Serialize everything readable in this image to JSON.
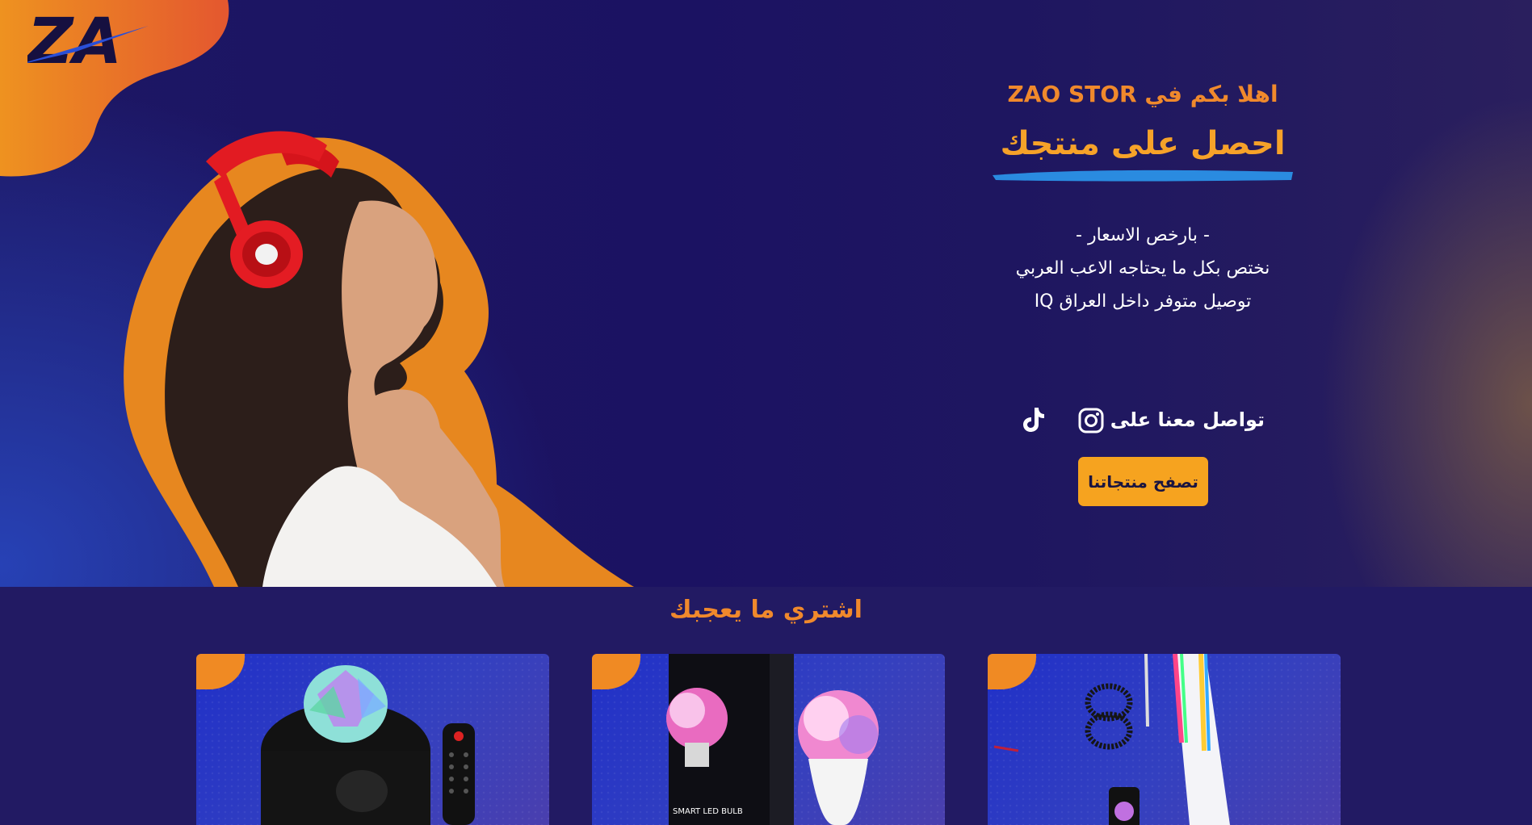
{
  "brand": {
    "logo_text": "ZA",
    "colors": {
      "accent_orange": "#f0892c",
      "button_orange": "#f6a31f",
      "brush_blue": "#2a8be0",
      "bg_navy": "#1d1764"
    }
  },
  "hero": {
    "welcome": "اهلا بكم في ZAO STOR",
    "headline": "احصل على منتجك",
    "lines": [
      "- بارخص الاسعار -",
      "نختص بكل ما يحتاجه الاعب العربي",
      "توصيل متوفر داخل العراق IQ"
    ],
    "contact_label": "تواصل معنا على",
    "social_icons": [
      "instagram-icon",
      "tiktok-icon"
    ],
    "cta_label": "تصفح منتجاتنا"
  },
  "products": {
    "section_title": "اشتري ما يعجبك",
    "cards": [
      {
        "name": "galaxy-projector",
        "image": "star-projector-speaker"
      },
      {
        "name": "smart-led-bulb",
        "image": "smart-led-bulb-box",
        "box_text": "SMART LED BULB"
      },
      {
        "name": "rgb-led-strip",
        "image": "console-led-strip"
      }
    ]
  }
}
